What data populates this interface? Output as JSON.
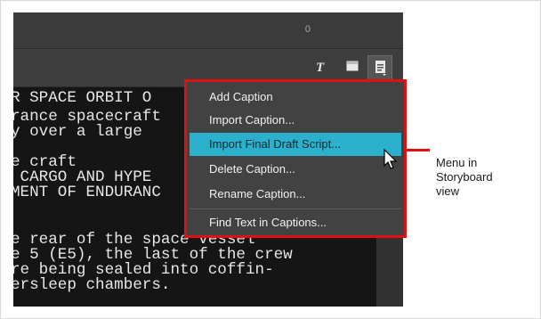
{
  "topbar": {
    "value": "0"
  },
  "toolbar": {
    "icons": [
      "text-tool-icon",
      "square-icon",
      "document-menu-icon"
    ]
  },
  "script": {
    "lines": [
      "R SPACE ORBIT O",
      "rance spacecraft",
      "y over a large",
      "",
      "e craft",
      " CARGO AND HYPE",
      "MENT OF ENDURANC",
      "",
      "e rear of the space vessel",
      "e 5 (E5), the last of the crew",
      "re being sealed into coffin-",
      "ersleep chambers."
    ]
  },
  "menu": {
    "items": [
      {
        "label": "Add Caption",
        "highlighted": false
      },
      {
        "label": "Import Caption...",
        "highlighted": false
      },
      {
        "label": "Import Final Draft Script...",
        "highlighted": true
      },
      {
        "label": "Delete Caption...",
        "highlighted": false
      },
      {
        "label": "Rename Caption...",
        "highlighted": false
      },
      {
        "label": "Find Text in Captions...",
        "highlighted": false
      }
    ],
    "highlight_color": "#2bb1cb",
    "border_color": "#e01010"
  },
  "callout": {
    "text": "Menu in\nStoryboard\nview"
  }
}
